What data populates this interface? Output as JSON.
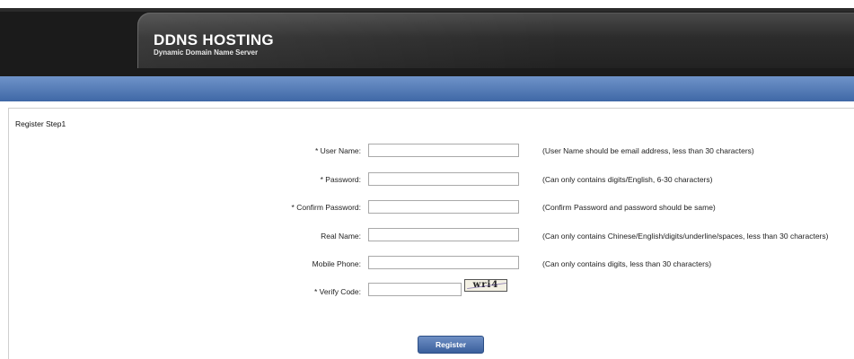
{
  "header": {
    "title": "DDNS HOSTING",
    "subtitle": "Dynamic Domain Name Server"
  },
  "form": {
    "step_title": "Register Step1",
    "fields": {
      "user_name": {
        "label": "* User Name:",
        "value": "",
        "hint": "(User Name should be email address, less than 30 characters)"
      },
      "password": {
        "label": "* Password:",
        "value": "",
        "hint": "(Can only contains digits/English, 6-30 characters)"
      },
      "confirm_password": {
        "label": "* Confirm Password:",
        "value": "",
        "hint": "(Confirm Password and password should be same)"
      },
      "real_name": {
        "label": "Real Name:",
        "value": "",
        "hint": "(Can only contains Chinese/English/digits/underline/spaces, less than 30 characters)"
      },
      "mobile_phone": {
        "label": "Mobile Phone:",
        "value": "",
        "hint": "(Can only contains digits, less than 30 characters)"
      },
      "verify_code": {
        "label": "* Verify Code:",
        "value": "",
        "captcha_text": "wri4"
      }
    },
    "register_label": "Register"
  },
  "colors": {
    "header_bg": "#1b1b1b",
    "nav_bar": "#4f77b5",
    "button": "#4b6ea8"
  }
}
